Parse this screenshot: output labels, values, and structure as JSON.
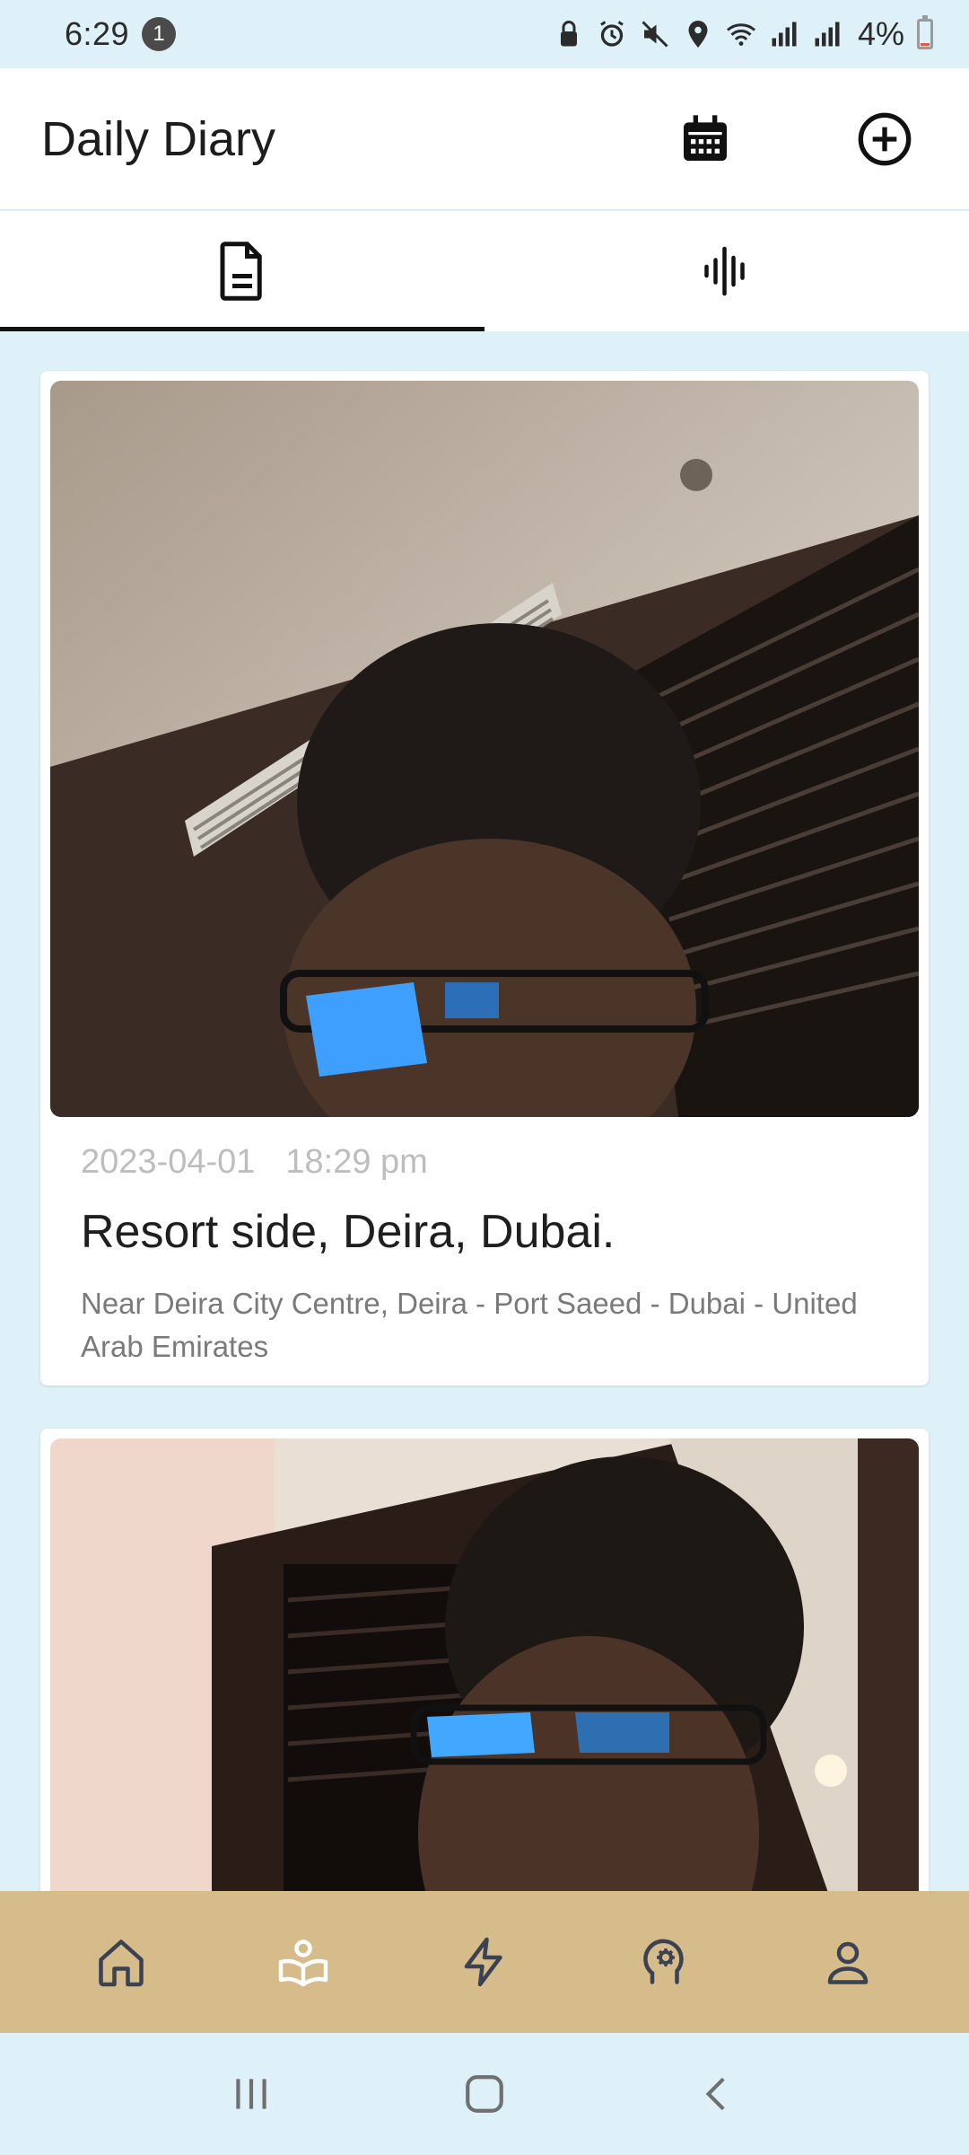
{
  "status_bar": {
    "time": "6:29",
    "notification_count": "1",
    "battery": "4%"
  },
  "app_bar": {
    "title": "Daily Diary",
    "icons": [
      "calendar-icon",
      "add-circle-icon"
    ]
  },
  "tabs": [
    {
      "name": "text-entries",
      "icon": "document-icon",
      "active": true
    },
    {
      "name": "audio-entries",
      "icon": "audio-wave-icon",
      "active": false
    }
  ],
  "entries": [
    {
      "date": "2023-04-01",
      "time": "18:29 pm",
      "title": "Resort side, Deira, Dubai.",
      "location": "Near Deira City Centre, Deira - Port Saeed - Dubai - United Arab Emirates"
    }
  ],
  "bottom_nav": [
    {
      "icon": "home-icon"
    },
    {
      "icon": "book-reader-icon"
    },
    {
      "icon": "lightning-icon"
    },
    {
      "icon": "mind-gear-icon"
    },
    {
      "icon": "profile-icon"
    }
  ],
  "colors": {
    "background": "#def1f8",
    "bottom_nav": "#d5bc8a",
    "icon_color": "#3b4252"
  }
}
